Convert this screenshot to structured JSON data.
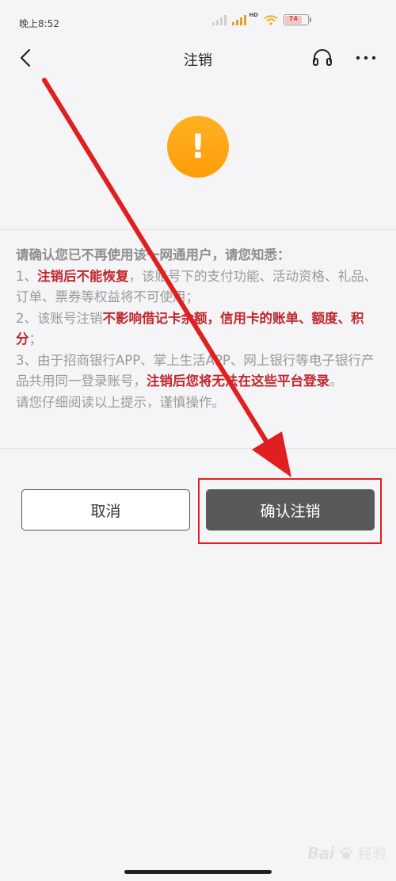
{
  "status_bar": {
    "time": "晚上8:52",
    "network_label": "HD",
    "battery": "74"
  },
  "nav": {
    "title": "注销",
    "icons": [
      "back-arrow-icon",
      "headset-icon",
      "more-icon"
    ]
  },
  "warning": {
    "icon_glyph": "!",
    "color": "#ff9c0a"
  },
  "notice": {
    "heading": "请确认您已不再使用该一网通用户，请您知悉：",
    "item1_prefix": "1、",
    "item1_red": "注销后不能恢复",
    "item1_rest": "，该账号下的支付功能、活动资格、礼品、订单、票券等权益将不可使用；",
    "item2_prefix": "2、该账号注销",
    "item2_red": "不影响借记卡余额，信用卡的账单、额度、积分",
    "item2_rest": "；",
    "item3_prefix": "3、由于招商银行APP、掌上生活APP、网上银行等电子银行产品共用同一登录账号，",
    "item3_red": "注销后您将无法在这些平台登录",
    "item3_rest": "。",
    "footer": "请您仔细阅读以上提示，谨慎操作。",
    "highlight_color": "#c0272d"
  },
  "buttons": {
    "cancel": "取消",
    "confirm": "确认注销",
    "confirm_color": "#58595b"
  },
  "annotation": {
    "arrow_color": "#e02020"
  },
  "watermark": {
    "brand": "Bai",
    "cn": "经验"
  }
}
